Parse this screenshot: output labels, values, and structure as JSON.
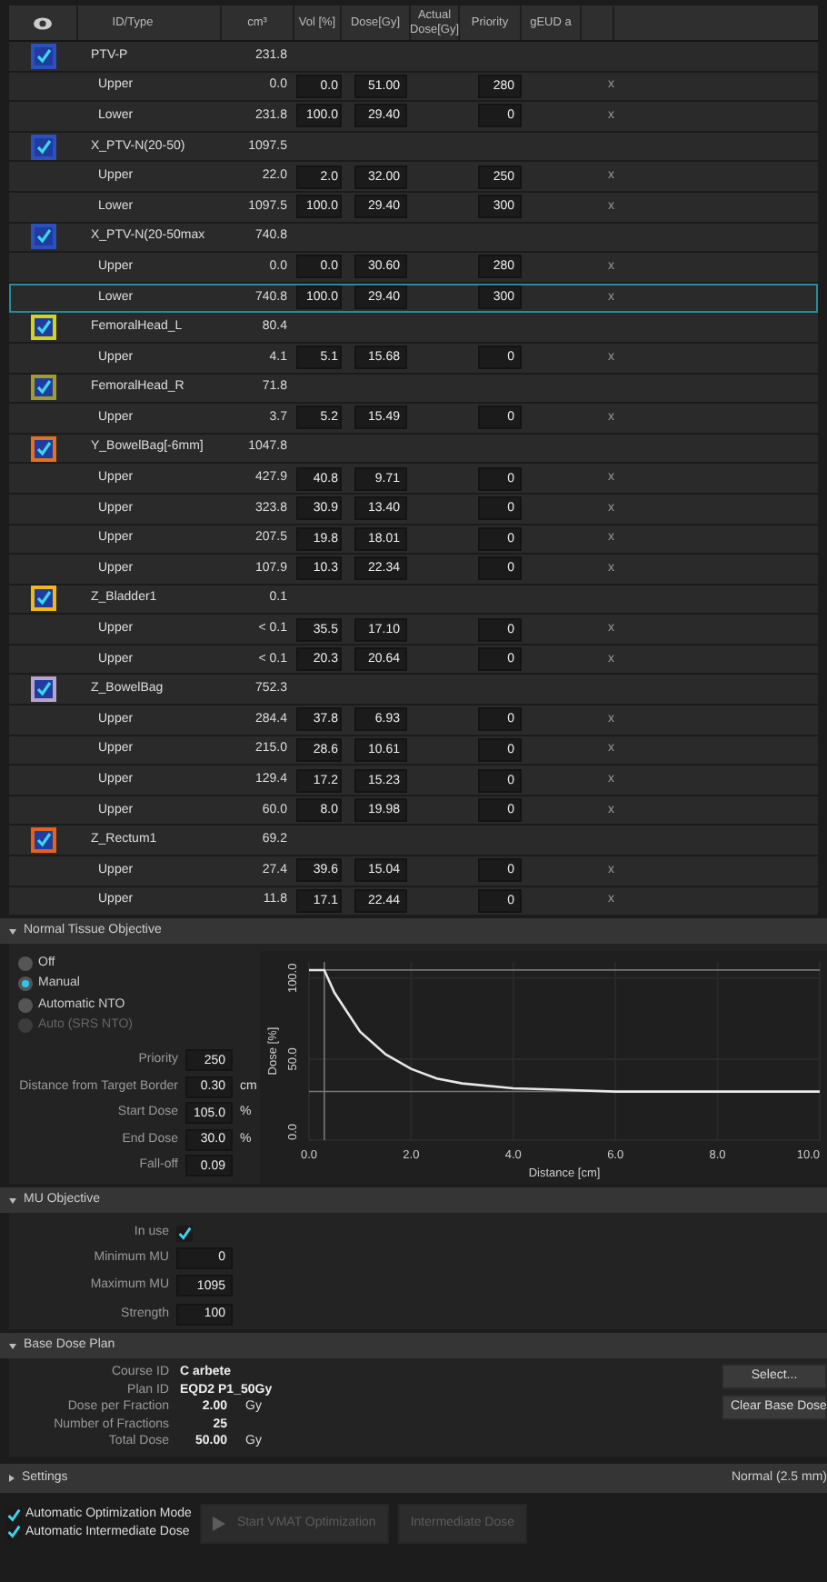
{
  "table": {
    "columns": [
      "ID/Type",
      "cm³",
      "Vol [%]",
      "Dose[Gy]",
      "Actual Dose[Gy]",
      "Priority",
      "gEUD a"
    ],
    "structures": [
      {
        "name": "PTV-P",
        "color": "#2c50bc",
        "visible": true,
        "volume": "231.8",
        "objectives": [
          {
            "type": "Upper",
            "volume": "0.0",
            "vol_percent": "0.0",
            "dose": "51.00",
            "priority": "280",
            "remove": "x",
            "selected": false
          },
          {
            "type": "Lower",
            "volume": "231.8",
            "vol_percent": "100.0",
            "dose": "29.40",
            "priority": "0",
            "remove": "x",
            "selected": false
          }
        ]
      },
      {
        "name": "X_PTV-N(20-50)",
        "color": "#2c50bc",
        "visible": true,
        "volume": "1097.5",
        "objectives": [
          {
            "type": "Upper",
            "volume": "22.0",
            "vol_percent": "2.0",
            "dose": "32.00",
            "priority": "250",
            "remove": "x",
            "selected": false
          },
          {
            "type": "Lower",
            "volume": "1097.5",
            "vol_percent": "100.0",
            "dose": "29.40",
            "priority": "300",
            "remove": "x",
            "selected": false
          }
        ]
      },
      {
        "name": "X_PTV-N(20-50max",
        "color": "#2c50bc",
        "visible": true,
        "volume": "740.8",
        "objectives": [
          {
            "type": "Upper",
            "volume": "0.0",
            "vol_percent": "0.0",
            "dose": "30.60",
            "priority": "280",
            "remove": "x",
            "selected": false
          },
          {
            "type": "Lower",
            "volume": "740.8",
            "vol_percent": "100.0",
            "dose": "29.40",
            "priority": "300",
            "remove": "x",
            "selected": true
          }
        ]
      },
      {
        "name": "FemoralHead_L",
        "color": "#d6d21a",
        "visible": true,
        "volume": "80.4",
        "objectives": [
          {
            "type": "Upper",
            "volume": "4.1",
            "vol_percent": "5.1",
            "dose": "15.68",
            "priority": "0",
            "remove": "x",
            "selected": false
          }
        ]
      },
      {
        "name": "FemoralHead_R",
        "color": "#a39c2a",
        "visible": true,
        "volume": "71.8",
        "objectives": [
          {
            "type": "Upper",
            "volume": "3.7",
            "vol_percent": "5.2",
            "dose": "15.49",
            "priority": "0",
            "remove": "x",
            "selected": false
          }
        ]
      },
      {
        "name": "Y_BowelBag[-6mm]",
        "color": "#e8701c",
        "visible": true,
        "volume": "1047.8",
        "objectives": [
          {
            "type": "Upper",
            "volume": "427.9",
            "vol_percent": "40.8",
            "dose": "9.71",
            "priority": "0",
            "remove": "x",
            "selected": false
          },
          {
            "type": "Upper",
            "volume": "323.8",
            "vol_percent": "30.9",
            "dose": "13.40",
            "priority": "0",
            "remove": "x",
            "selected": false
          },
          {
            "type": "Upper",
            "volume": "207.5",
            "vol_percent": "19.8",
            "dose": "18.01",
            "priority": "0",
            "remove": "x",
            "selected": false
          },
          {
            "type": "Upper",
            "volume": "107.9",
            "vol_percent": "10.3",
            "dose": "22.34",
            "priority": "0",
            "remove": "x",
            "selected": false
          }
        ]
      },
      {
        "name": "Z_Bladder1",
        "color": "#f0b818",
        "visible": true,
        "volume": "0.1",
        "objectives": [
          {
            "type": "Upper",
            "volume": "< 0.1",
            "vol_percent": "35.5",
            "dose": "17.10",
            "priority": "0",
            "remove": "x",
            "selected": false
          },
          {
            "type": "Upper",
            "volume": "< 0.1",
            "vol_percent": "20.3",
            "dose": "20.64",
            "priority": "0",
            "remove": "x",
            "selected": false
          }
        ]
      },
      {
        "name": "Z_BowelBag",
        "color": "#b9a2cc",
        "visible": true,
        "volume": "752.3",
        "objectives": [
          {
            "type": "Upper",
            "volume": "284.4",
            "vol_percent": "37.8",
            "dose": "6.93",
            "priority": "0",
            "remove": "x",
            "selected": false
          },
          {
            "type": "Upper",
            "volume": "215.0",
            "vol_percent": "28.6",
            "dose": "10.61",
            "priority": "0",
            "remove": "x",
            "selected": false
          },
          {
            "type": "Upper",
            "volume": "129.4",
            "vol_percent": "17.2",
            "dose": "15.23",
            "priority": "0",
            "remove": "x",
            "selected": false
          },
          {
            "type": "Upper",
            "volume": "60.0",
            "vol_percent": "8.0",
            "dose": "19.98",
            "priority": "0",
            "remove": "x",
            "selected": false
          }
        ]
      },
      {
        "name": "Z_Rectum1",
        "color": "#e8601c",
        "visible": true,
        "volume": "69.2",
        "objectives": [
          {
            "type": "Upper",
            "volume": "27.4",
            "vol_percent": "39.6",
            "dose": "15.04",
            "priority": "0",
            "remove": "x",
            "selected": false
          },
          {
            "type": "Upper",
            "volume": "11.8",
            "vol_percent": "17.1",
            "dose": "22.44",
            "priority": "0",
            "remove": "x",
            "selected": false
          }
        ]
      }
    ]
  },
  "normal_tissue_objective": {
    "title": "Normal Tissue Objective",
    "expanded": true,
    "modes": [
      {
        "label": "Off",
        "selected": false,
        "disabled": false
      },
      {
        "label": "Manual",
        "selected": true,
        "disabled": false
      },
      {
        "label": "Automatic NTO",
        "selected": false,
        "disabled": false
      },
      {
        "label": "Auto (SRS NTO)",
        "selected": false,
        "disabled": true
      }
    ],
    "fields": [
      {
        "label": "Priority",
        "value": "250"
      },
      {
        "label": "Distance from Target Border",
        "value": "0.30",
        "unit": "cm"
      },
      {
        "label": "Start Dose",
        "value": "105.0",
        "unit": "%"
      },
      {
        "label": "End Dose",
        "value": "30.0",
        "unit": "%"
      },
      {
        "label": "Fall-off",
        "value": "0.09"
      }
    ],
    "chart_data": {
      "type": "line",
      "xlabel": "Distance [cm]",
      "ylabel": "Dose [%]",
      "x": [
        0,
        0.3,
        0.5,
        1,
        1.5,
        2,
        2.5,
        3,
        4,
        5,
        6,
        8,
        10
      ],
      "series": [
        {
          "color": "#e8e8e8",
          "values": [
            105,
            105,
            91,
            67,
            53,
            44,
            38,
            35,
            32,
            31,
            30,
            30,
            30
          ]
        }
      ],
      "grid": true,
      "xlim": [
        0,
        10
      ],
      "ylim": [
        0,
        110
      ],
      "xticks": [
        {
          "value": 0,
          "label": "0.0"
        },
        {
          "value": 2,
          "label": "2.0"
        },
        {
          "value": 4,
          "label": "4.0"
        },
        {
          "value": 6,
          "label": "6.0"
        },
        {
          "value": 8,
          "label": "8.0"
        },
        {
          "value": 10,
          "label": "10.0"
        }
      ],
      "yticks": [
        {
          "value": 0,
          "label": "0.0"
        },
        {
          "value": 50,
          "label": "50.0"
        },
        {
          "value": 100,
          "label": "100.0"
        }
      ]
    }
  },
  "mu_objective": {
    "title": "MU Objective",
    "expanded": true,
    "in_use": {
      "label": "In use",
      "checked": true
    },
    "fields": [
      {
        "label": "Minimum MU",
        "value": "0"
      },
      {
        "label": "Maximum MU",
        "value": "1095"
      },
      {
        "label": "Strength",
        "value": "100"
      }
    ]
  },
  "base_dose_plan": {
    "title": "Base Dose Plan",
    "expanded": true,
    "fields": [
      {
        "label": "Course ID",
        "value": "C arbete"
      },
      {
        "label": "Plan ID",
        "value": "EQD2 P1_50Gy"
      },
      {
        "label": "Dose per Fraction",
        "value": "2.00",
        "unit": "Gy"
      },
      {
        "label": "Number of Fractions",
        "value": "25"
      },
      {
        "label": "Total Dose",
        "value": "50.00",
        "unit": "Gy"
      }
    ],
    "buttons": [
      "Select...",
      "Clear Base Dose"
    ]
  },
  "settings": {
    "title": "Settings",
    "expanded": false,
    "value": "Normal (2.5 mm)"
  },
  "footer": {
    "options": [
      {
        "label": "Automatic Optimization Mode",
        "checked": true
      },
      {
        "label": "Automatic Intermediate Dose",
        "checked": true
      }
    ],
    "buttons": [
      {
        "label": "Start VMAT Optimization",
        "kind": "play",
        "disabled": true
      },
      {
        "label": "Intermediate Dose",
        "kind": "plain",
        "disabled": true
      }
    ]
  }
}
